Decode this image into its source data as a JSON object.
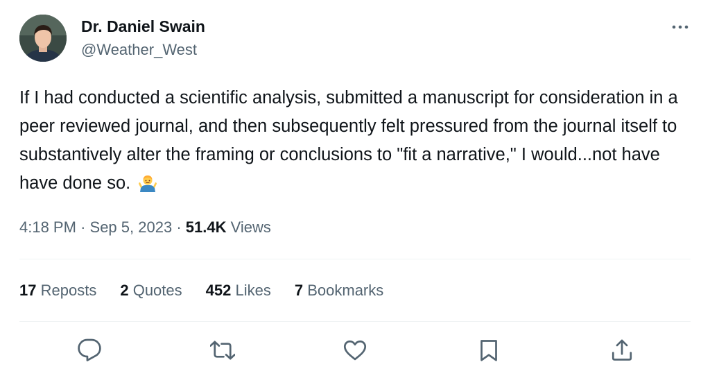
{
  "author": {
    "name": "Dr. Daniel Swain",
    "handle": "@Weather_West"
  },
  "tweet": {
    "text": "If I had conducted a scientific analysis, submitted a manuscript for consideration in a peer reviewed journal, and then subsequently felt pressured from the journal itself to substantively alter the framing or conclusions to \"fit a narrative,\" I would...not have have done so.",
    "emoji": "man-shrugging-emoji"
  },
  "meta": {
    "time": "4:18 PM",
    "separator": "·",
    "date": "Sep 5, 2023",
    "views_count": "51.4K",
    "views_label": "Views"
  },
  "stats": {
    "reposts_count": "17",
    "reposts_label": "Reposts",
    "quotes_count": "2",
    "quotes_label": "Quotes",
    "likes_count": "452",
    "likes_label": "Likes",
    "bookmarks_count": "7",
    "bookmarks_label": "Bookmarks"
  },
  "actions": [
    "reply-icon",
    "repost-icon",
    "like-icon",
    "bookmark-icon",
    "share-icon"
  ],
  "colors": {
    "text": "#0f1419",
    "secondary": "#536471",
    "divider": "#eff3f4"
  }
}
